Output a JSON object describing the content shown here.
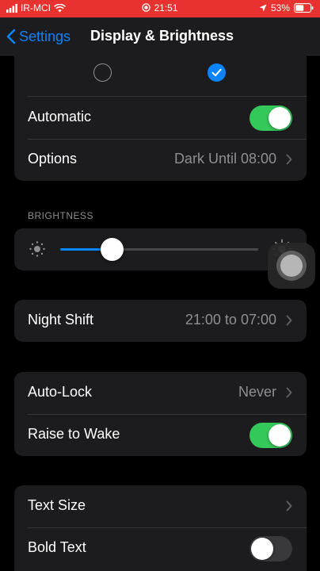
{
  "status_bar": {
    "carrier": "IR-MCI",
    "time": "21:51",
    "battery": "53%",
    "color": "#e8322f"
  },
  "nav": {
    "back_label": "Settings",
    "title": "Display & Brightness"
  },
  "appearance": {
    "light_selected": false,
    "dark_selected": true,
    "automatic_label": "Automatic",
    "automatic_on": true,
    "options_label": "Options",
    "options_value": "Dark Until 08:00"
  },
  "brightness": {
    "header": "BRIGHTNESS",
    "level": 0.26
  },
  "night_shift": {
    "label": "Night Shift",
    "value": "21:00 to 07:00"
  },
  "lock": {
    "auto_lock_label": "Auto-Lock",
    "auto_lock_value": "Never",
    "raise_to_wake_label": "Raise to Wake",
    "raise_to_wake_on": true
  },
  "text": {
    "text_size_label": "Text Size",
    "bold_text_label": "Bold Text",
    "bold_text_on": false
  },
  "colors": {
    "accent": "#0a84ff",
    "toggle_on": "#34c759",
    "cell_bg": "#1c1c1e"
  }
}
